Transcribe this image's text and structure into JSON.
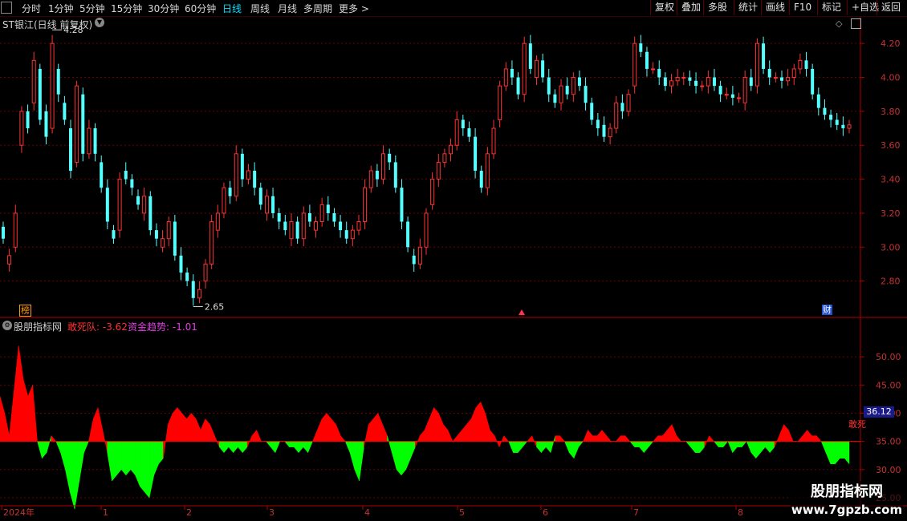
{
  "toolbar": {
    "periods": [
      "分时",
      "1分钟",
      "5分钟",
      "15分钟",
      "30分钟",
      "60分钟",
      "日线",
      "周线",
      "月线",
      "多周期",
      "更多 >"
    ],
    "active_period": "日线",
    "right_buttons": [
      "复权",
      "叠加",
      "多股",
      "统计",
      "画线",
      "F10",
      "标记",
      "+自选",
      "返回"
    ]
  },
  "chart": {
    "title": "ST银江(日线 前复权)",
    "y_ticks": [
      "4.20",
      "4.00",
      "3.80",
      "3.60",
      "3.40",
      "3.20",
      "3.00",
      "2.80"
    ],
    "high_label": "4.28",
    "low_label": "2.65",
    "badge_left": "榜",
    "badge_right": "财",
    "colors": {
      "up": "#ff3232",
      "down": "#54ffff",
      "grid": "#6a0000",
      "axis": "#8a0000"
    }
  },
  "indicator": {
    "name": "股朋指标网",
    "series1_label": "敢死队",
    "series1_value": "-3.62",
    "series2_label": "资金趋势",
    "series2_value": "-1.01",
    "y_ticks": [
      "50.00",
      "45.00",
      "40.00",
      "35.00",
      "30.00",
      "25.00"
    ],
    "current_value": "36.12",
    "line_tag": "敢死",
    "colors": {
      "pos": "#ff0000",
      "neg": "#00ff00"
    }
  },
  "x_axis": {
    "labels": [
      "2024年",
      "1",
      "2",
      "3",
      "4",
      "5",
      "6",
      "7",
      "8"
    ]
  },
  "watermark": {
    "line1": "股朋指标网",
    "line2": "www.7gpzb.com"
  },
  "chart_data": [
    {
      "type": "candlestick",
      "title": "ST银江(日线 前复权)",
      "ylim": [
        2.6,
        4.3
      ],
      "y_ticks": [
        2.8,
        3.0,
        3.2,
        3.4,
        3.6,
        3.8,
        4.0,
        4.2
      ],
      "x_labels": [
        "2024年",
        "1",
        "2",
        "3",
        "4",
        "5",
        "6",
        "7",
        "8"
      ],
      "annotations": [
        {
          "label": "4.28",
          "value": 4.28
        },
        {
          "label": "2.65",
          "value": 2.65
        }
      ],
      "close": [
        3.05,
        2.95,
        3.2,
        3.8,
        3.7,
        4.1,
        3.75,
        3.65,
        4.2,
        3.9,
        3.75,
        3.45,
        3.95,
        3.55,
        3.7,
        3.55,
        3.35,
        3.15,
        3.05,
        3.4,
        3.4,
        3.35,
        3.25,
        3.3,
        3.1,
        3.05,
        3.05,
        3.15,
        2.95,
        2.85,
        2.8,
        2.7,
        2.75,
        2.9,
        3.15,
        3.2,
        3.35,
        3.3,
        3.55,
        3.4,
        3.45,
        3.35,
        3.25,
        3.3,
        3.2,
        3.15,
        3.1,
        3.15,
        3.05,
        3.2,
        3.15,
        3.15,
        3.25,
        3.2,
        3.15,
        3.1,
        3.05,
        3.1,
        3.15,
        3.35,
        3.45,
        3.4,
        3.55,
        3.5,
        3.35,
        3.15,
        3.0,
        2.9,
        3.0,
        3.2,
        3.4,
        3.5,
        3.55,
        3.6,
        3.75,
        3.7,
        3.65,
        3.45,
        3.35,
        3.55,
        3.7,
        3.95,
        4.05,
        4.0,
        3.9,
        4.2,
        4.05,
        4.1,
        4.0,
        3.9,
        3.85,
        3.95,
        3.9,
        4.0,
        3.95,
        3.85,
        3.75,
        3.7,
        3.65,
        3.7,
        3.85,
        3.8,
        3.9,
        4.2,
        4.15,
        4.05,
        4.05,
        4.0,
        3.95,
        3.98,
        4.0,
        4.0,
        3.98,
        3.95,
        3.95,
        4.0,
        3.95,
        3.9,
        3.9,
        3.88,
        3.88,
        4.0,
        3.95,
        4.2,
        4.05,
        4.0,
        4.0,
        3.98,
        4.0,
        4.05,
        4.1,
        4.05,
        3.9,
        3.82,
        3.78,
        3.75,
        3.72,
        3.7,
        3.72
      ],
      "open": [
        3.12,
        2.9,
        3.0,
        3.6,
        3.8,
        3.85,
        4.05,
        3.8,
        3.7,
        4.05,
        3.85,
        3.7,
        3.5,
        3.9,
        3.55,
        3.7,
        3.5,
        3.35,
        3.1,
        3.1,
        3.45,
        3.4,
        3.3,
        3.2,
        3.3,
        3.1,
        3.0,
        3.05,
        3.15,
        2.95,
        2.85,
        2.8,
        2.7,
        2.8,
        2.9,
        3.1,
        3.2,
        3.35,
        3.3,
        3.55,
        3.4,
        3.45,
        3.35,
        3.2,
        3.3,
        3.2,
        3.15,
        3.05,
        3.15,
        3.05,
        3.2,
        3.1,
        3.15,
        3.25,
        3.2,
        3.15,
        3.1,
        3.05,
        3.1,
        3.15,
        3.35,
        3.45,
        3.4,
        3.55,
        3.5,
        3.35,
        3.15,
        2.95,
        2.9,
        3.0,
        3.25,
        3.4,
        3.5,
        3.55,
        3.6,
        3.75,
        3.7,
        3.65,
        3.45,
        3.35,
        3.55,
        3.75,
        3.95,
        4.05,
        4.0,
        3.9,
        4.2,
        4.0,
        4.1,
        4.0,
        3.9,
        3.85,
        3.95,
        3.9,
        4.0,
        3.95,
        3.85,
        3.75,
        3.72,
        3.65,
        3.7,
        3.85,
        3.8,
        3.95,
        4.2,
        4.15,
        4.05,
        4.05,
        4.0,
        3.95,
        3.98,
        4.0,
        4.0,
        3.98,
        3.95,
        3.95,
        4.0,
        3.95,
        3.9,
        3.9,
        3.88,
        3.85,
        4.0,
        3.95,
        4.2,
        4.05,
        4.0,
        4.0,
        3.98,
        4.0,
        4.05,
        4.1,
        4.05,
        3.9,
        3.82,
        3.78,
        3.75,
        3.72,
        3.7
      ]
    },
    {
      "type": "area",
      "title": "股朋指标网",
      "baseline": 35.0,
      "ylim": [
        24,
        55
      ],
      "y_ticks": [
        25,
        30,
        35,
        40,
        45,
        50
      ],
      "series": [
        {
          "name": "敢死队",
          "values": [
            43,
            40,
            36,
            44,
            52,
            46,
            43,
            45,
            35,
            32,
            33,
            36,
            35,
            33,
            30,
            26,
            23,
            28,
            33,
            35,
            39,
            41,
            37,
            33,
            28,
            29,
            30,
            29,
            30,
            29,
            27,
            26,
            25,
            29,
            31,
            32,
            38,
            40,
            41,
            40,
            39,
            40,
            39,
            37,
            39,
            38,
            36,
            34,
            33,
            34,
            33,
            34,
            33,
            34,
            36,
            37,
            35,
            35,
            34,
            33,
            35,
            35,
            34,
            34,
            33,
            34,
            33,
            35,
            37,
            39,
            40,
            39,
            38,
            36,
            35,
            33,
            30,
            28,
            34,
            38,
            39,
            40,
            38,
            36,
            33,
            30,
            29,
            30,
            32,
            34,
            36,
            37,
            39,
            41,
            40,
            38,
            37,
            35,
            36,
            37,
            38,
            39,
            41,
            42,
            40,
            37,
            36,
            34,
            36,
            35,
            33,
            33,
            34,
            35,
            36,
            34,
            33,
            34,
            33,
            36,
            36,
            35,
            33,
            32,
            34,
            35,
            37,
            36,
            36,
            37,
            36,
            35,
            35,
            36,
            36,
            35,
            34,
            34,
            33,
            34,
            35,
            36,
            36,
            37,
            38,
            36,
            35,
            35,
            34,
            33,
            33,
            34,
            36,
            35,
            34,
            34,
            35,
            33,
            34,
            34,
            35,
            33,
            32,
            33,
            34,
            33,
            34,
            36,
            38,
            37,
            35,
            35,
            36,
            37,
            36,
            36,
            35,
            33,
            31,
            31,
            32,
            32,
            31
          ]
        }
      ]
    }
  ]
}
